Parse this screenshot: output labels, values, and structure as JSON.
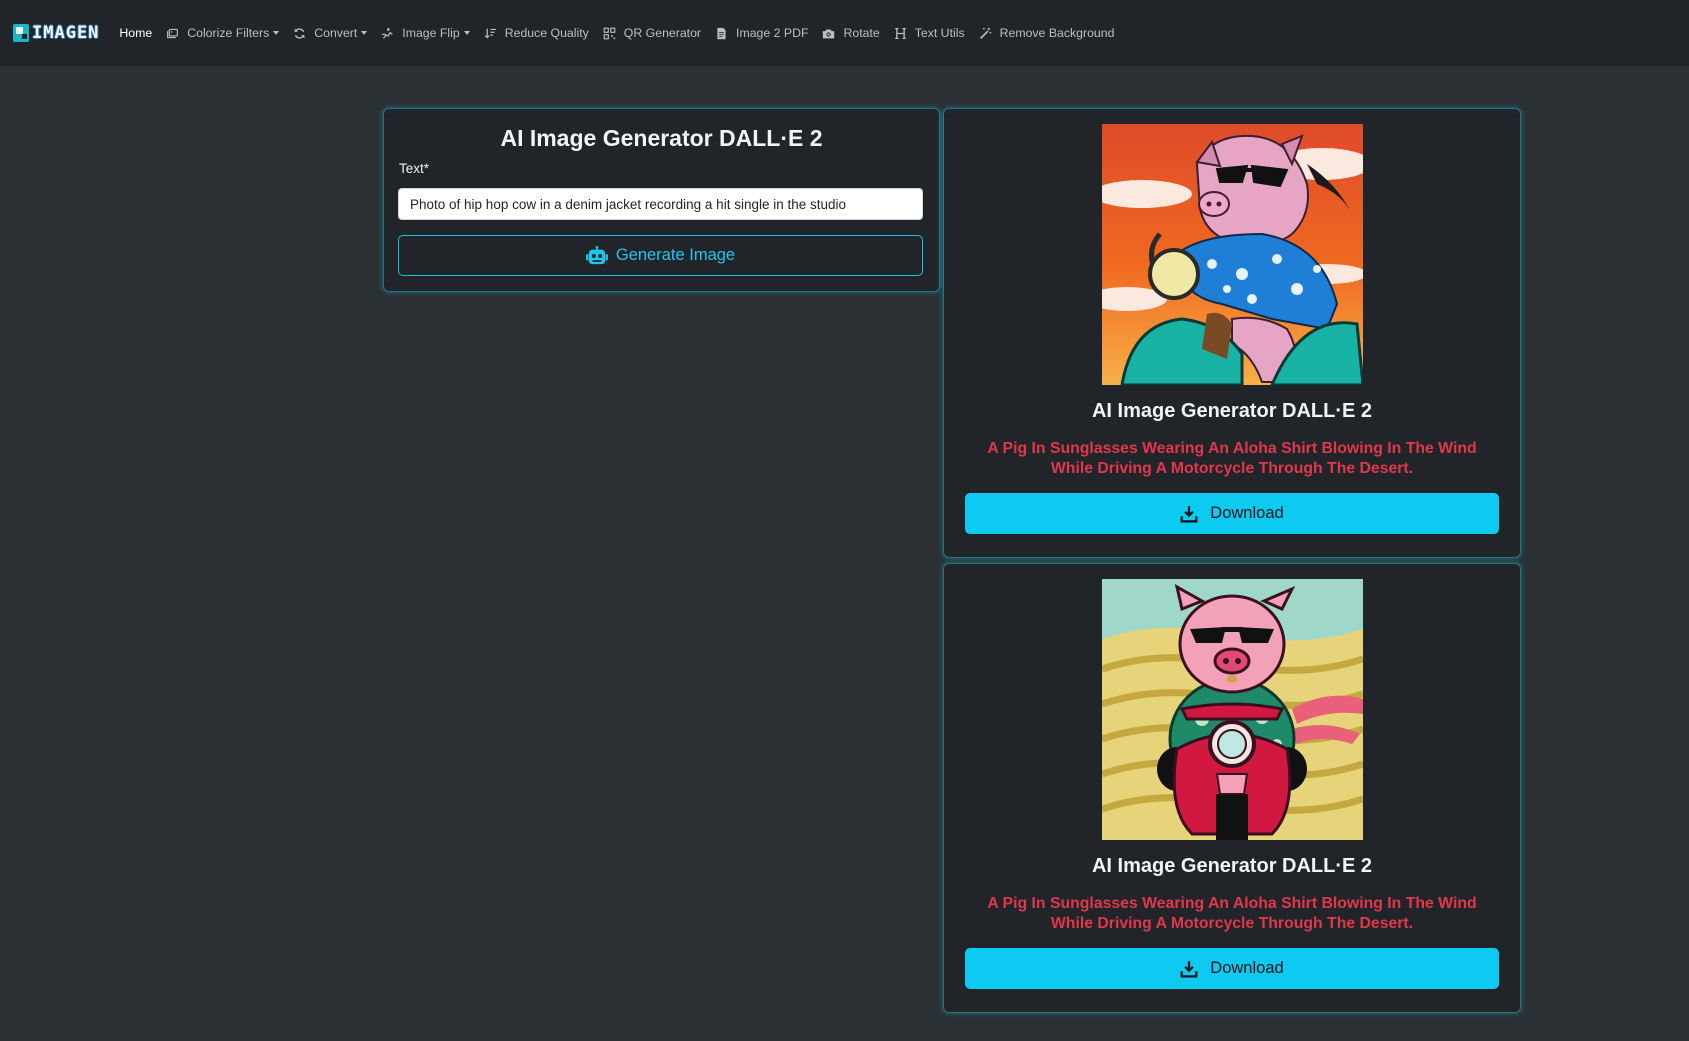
{
  "app": {
    "brand": "IMAGEN"
  },
  "nav": {
    "items": [
      {
        "label": "Home",
        "icon": "home",
        "active": true,
        "dropdown": false
      },
      {
        "label": "Colorize Filters",
        "icon": "images-icon",
        "dropdown": true
      },
      {
        "label": "Convert",
        "icon": "sync-icon",
        "dropdown": true
      },
      {
        "label": "Image Flip",
        "icon": "flip-icon",
        "dropdown": true
      },
      {
        "label": "Reduce Quality",
        "icon": "sort-down-icon",
        "dropdown": false
      },
      {
        "label": "QR Generator",
        "icon": "qrcode-icon",
        "dropdown": false
      },
      {
        "label": "Image 2 PDF",
        "icon": "file-icon",
        "dropdown": false
      },
      {
        "label": "Rotate",
        "icon": "camera-icon",
        "dropdown": false
      },
      {
        "label": "Text Utils",
        "icon": "heading-icon",
        "dropdown": false
      },
      {
        "label": "Remove Background",
        "icon": "magic-wand-icon",
        "dropdown": false
      }
    ]
  },
  "form": {
    "title": "AI Image Generator DALL·E 2",
    "label": "Text*",
    "input_value": "Photo of hip hop cow in a denim jacket recording a hit single in the studio",
    "button_label": "Generate Image"
  },
  "results": [
    {
      "title": "AI Image Generator DALL·E 2",
      "description": "A Pig In Sunglasses Wearing An Aloha Shirt Blowing In The Wind While Driving A Motorcycle Through The Desert.",
      "download_label": "Download"
    },
    {
      "title": "AI Image Generator DALL·E 2",
      "description": "A Pig In Sunglasses Wearing An Aloha Shirt Blowing In The Wind While Driving A Motorcycle Through The Desert.",
      "download_label": "Download"
    }
  ],
  "colors": {
    "page_bg": "#2b3035",
    "navbar_bg": "#212529",
    "card_bg": "#212529",
    "accent": "#0dcaf0",
    "description_red": "#e0384a"
  }
}
